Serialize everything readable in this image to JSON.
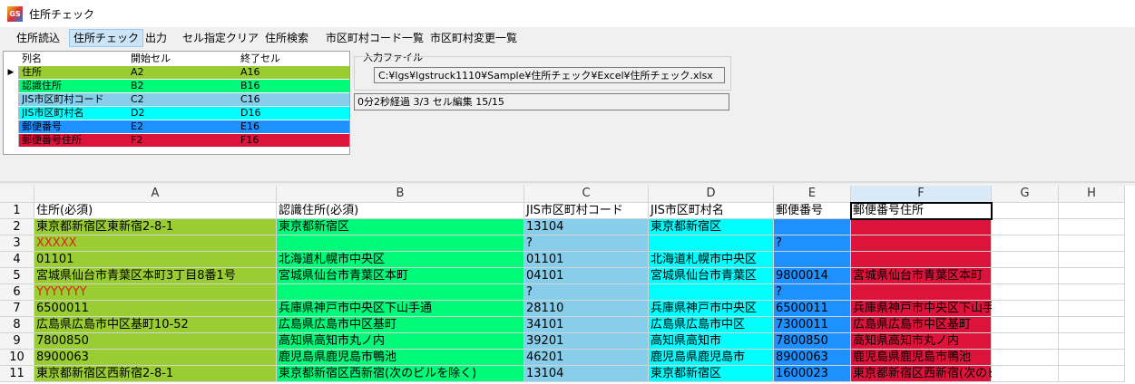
{
  "window": {
    "title": "住所チェック",
    "icon": "gs-app-icon"
  },
  "menu": [
    {
      "label": "住所読込",
      "active": false
    },
    {
      "label": "住所チェック",
      "active": true
    },
    {
      "label": "出力",
      "active": false
    },
    {
      "label": "セル指定クリア",
      "active": false
    },
    {
      "label": "住所検索",
      "active": false
    },
    {
      "label": "市区町村コード一覧",
      "active": false
    },
    {
      "label": "市区町村変更一覧",
      "active": false
    }
  ],
  "column_grid": {
    "headers": [
      "列名",
      "開始セル",
      "終了セル"
    ],
    "rows": [
      {
        "name": "住所",
        "start": "A2",
        "end": "A16",
        "color": "#9acd32"
      },
      {
        "name": "認識住所",
        "start": "B2",
        "end": "B16",
        "color": "#00fa7a"
      },
      {
        "name": "JIS市区町村コード",
        "start": "C2",
        "end": "C16",
        "color": "#87ceeb"
      },
      {
        "name": "JIS市区町村名",
        "start": "D2",
        "end": "D16",
        "color": "#00ffff"
      },
      {
        "name": "郵便番号",
        "start": "E2",
        "end": "E16",
        "color": "#1e90ff"
      },
      {
        "name": "郵便番号住所",
        "start": "F2",
        "end": "F16",
        "color": "#dc143c"
      }
    ]
  },
  "input_file": {
    "label": "入力ファイル",
    "path": "C:¥lgs¥lgstruck1110¥Sample¥住所チェック¥Excel¥住所チェック.xlsx"
  },
  "status": "0分2秒経過 3/3 セル編集 15/15",
  "sheet": {
    "columns": [
      "A",
      "B",
      "C",
      "D",
      "E",
      "F",
      "G",
      "H"
    ],
    "row_numbers": [
      "1",
      "2",
      "3",
      "4",
      "5",
      "6",
      "7",
      "8",
      "9",
      "10",
      "11"
    ],
    "rows": [
      [
        "住所(必須)",
        "認識住所(必須)",
        "JIS市区町村コード",
        "JIS市区町村名",
        "郵便番号",
        "郵便番号住所"
      ],
      [
        "東京都新宿区東新宿2-8-1",
        "東京都新宿区",
        "13104",
        "東京都新宿区",
        "",
        ""
      ],
      [
        "XXXXX",
        "",
        "?",
        "",
        "?",
        ""
      ],
      [
        "01101",
        "北海道札幌市中央区",
        "01101",
        "北海道札幌市中央区",
        "",
        ""
      ],
      [
        "宮城県仙台市青葉区本町3丁目8番1号",
        "宮城県仙台市青葉区本町",
        "04101",
        "宮城県仙台市青葉区",
        "9800014",
        "宮城県仙台市青葉区本町"
      ],
      [
        "YYYYYYY",
        "",
        "?",
        "",
        "?",
        ""
      ],
      [
        "6500011",
        "兵庫県神戸市中央区下山手通",
        "28110",
        "兵庫県神戸市中央区",
        "6500011",
        "兵庫県神戸市中央区下山手通"
      ],
      [
        "広島県広島市中区基町10-52",
        "広島県広島市中区基町",
        "34101",
        "広島県広島市中区",
        "7300011",
        "広島県広島市中区基町"
      ],
      [
        "7800850",
        "高知県高知市丸ノ内",
        "39201",
        "高知県高知市",
        "7800850",
        "高知県高知市丸ノ内"
      ],
      [
        "8900063",
        "鹿児島県鹿児島市鴨池",
        "46201",
        "鹿児島県鹿児島市",
        "8900063",
        "鹿児島県鹿児島市鴨池"
      ],
      [
        "東京都新宿区西新宿2-8-1",
        "東京都新宿区西新宿(次のビルを除く)",
        "13104",
        "東京都新宿区",
        "1600023",
        "東京都新宿区西新宿(次のビルを除く)"
      ]
    ],
    "selected_cell": "F2"
  }
}
